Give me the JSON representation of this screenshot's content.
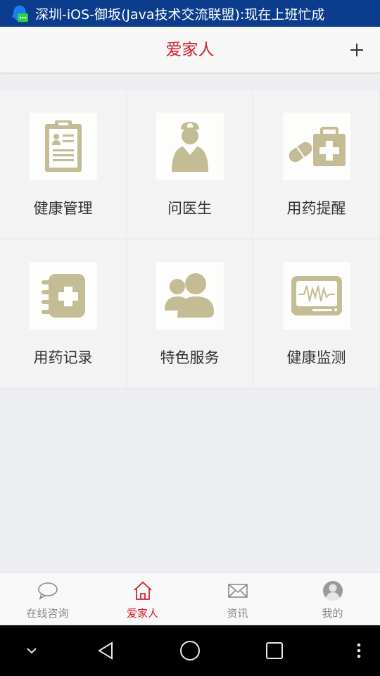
{
  "status_bar": {
    "notification_text": "深圳-iOS-御坂(Java技术交流联盟):现在上班忙成"
  },
  "header": {
    "title": "爱家人",
    "add_icon": "plus-icon"
  },
  "grid": {
    "icon_color": "#c4bc95",
    "items": [
      {
        "label": "健康管理",
        "icon": "clipboard-icon"
      },
      {
        "label": "问医生",
        "icon": "nurse-icon"
      },
      {
        "label": "用药提醒",
        "icon": "medicine-kit-icon"
      },
      {
        "label": "用药记录",
        "icon": "medical-notebook-icon"
      },
      {
        "label": "特色服务",
        "icon": "people-icon"
      },
      {
        "label": "健康监测",
        "icon": "heart-monitor-icon"
      }
    ]
  },
  "tabbar": {
    "accent": "#cc2229",
    "items": [
      {
        "label": "在线咨询",
        "icon": "chat-bubble-icon",
        "active": false
      },
      {
        "label": "爱家人",
        "icon": "home-icon",
        "active": true
      },
      {
        "label": "资讯",
        "icon": "mail-icon",
        "active": false
      },
      {
        "label": "我的",
        "icon": "user-icon",
        "active": false
      }
    ]
  },
  "nav_bar": {
    "buttons": [
      "chevron-down-icon",
      "back-icon",
      "home-circle-icon",
      "recents-icon",
      "more-icon"
    ]
  }
}
